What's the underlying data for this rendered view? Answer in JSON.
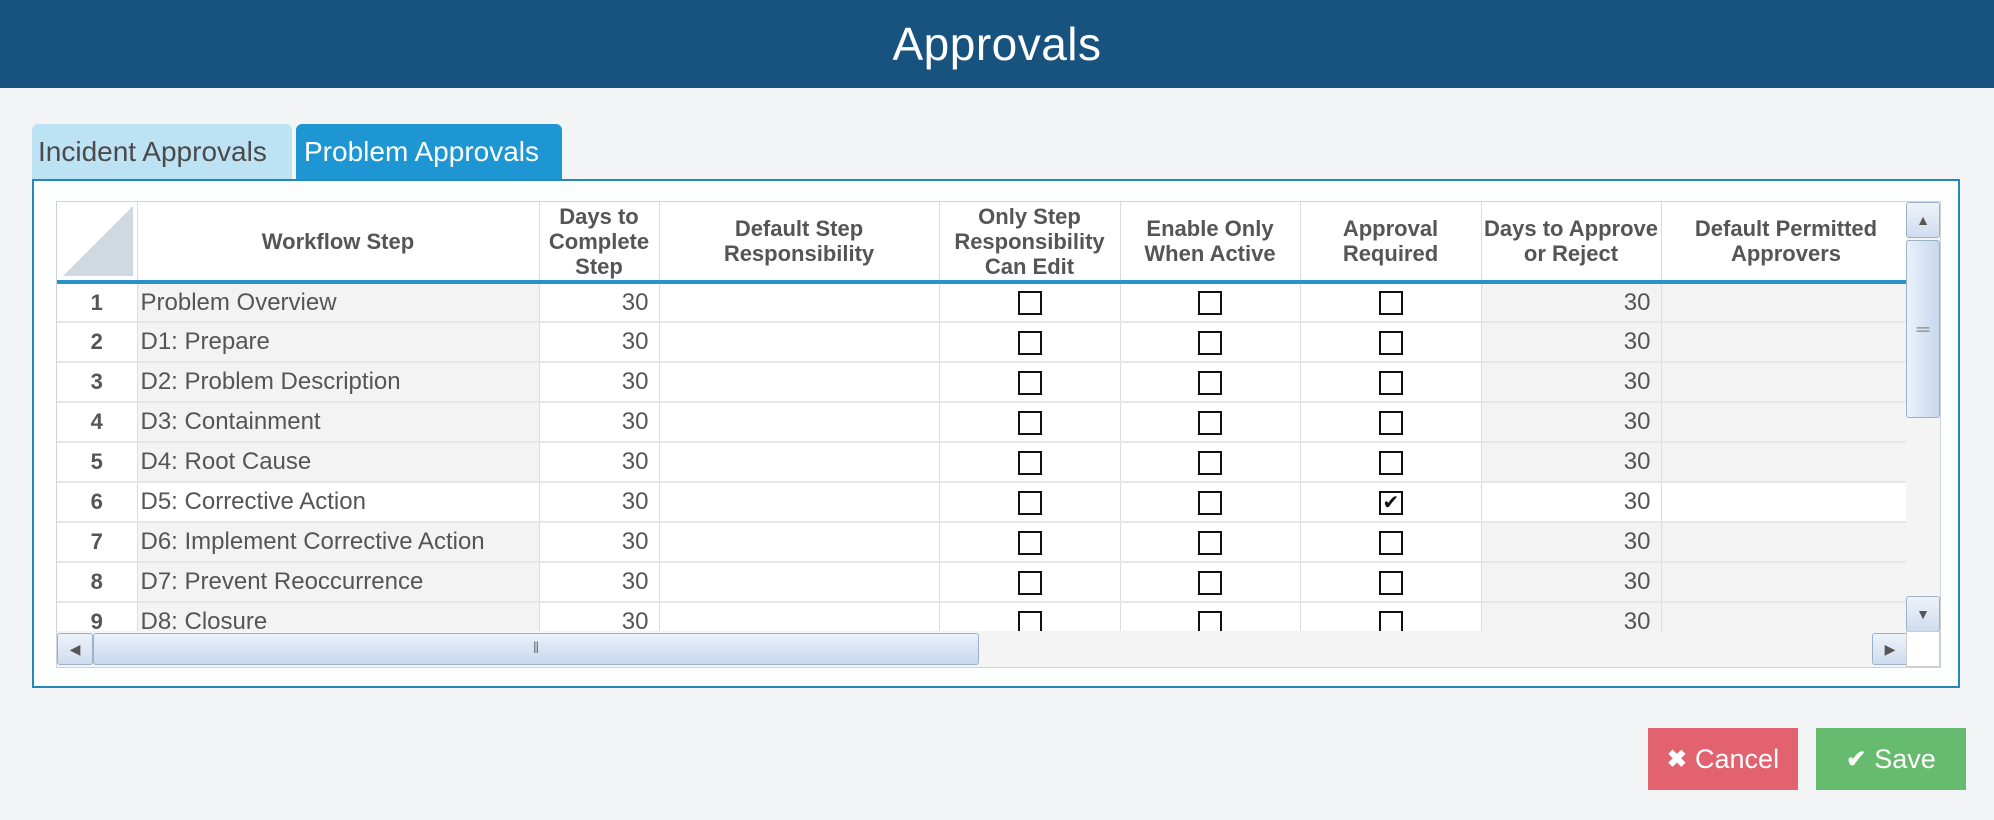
{
  "header": {
    "title": "Approvals"
  },
  "tabs": [
    {
      "label": "Incident Approvals",
      "active": false
    },
    {
      "label": "Problem Approvals",
      "active": true
    }
  ],
  "grid": {
    "columns": [
      {
        "key": "rownum",
        "label": ""
      },
      {
        "key": "step",
        "label": "Workflow Step"
      },
      {
        "key": "days_complete",
        "label": "Days to Complete Step"
      },
      {
        "key": "responsibility",
        "label": "Default Step Responsibility"
      },
      {
        "key": "only_resp_edit",
        "label": "Only Step Responsibility Can Edit"
      },
      {
        "key": "enable_active",
        "label": "Enable Only When Active"
      },
      {
        "key": "approval_required",
        "label": "Approval Required"
      },
      {
        "key": "days_approve",
        "label": "Days to Approve or Reject"
      },
      {
        "key": "approvers",
        "label": "Default Permitted Approvers"
      }
    ],
    "rows": [
      {
        "num": "1",
        "step": "Problem Overview",
        "days_complete": "30",
        "responsibility": "",
        "only_resp_edit": false,
        "enable_active": false,
        "approval_required": false,
        "days_approve": "30",
        "approvers": ""
      },
      {
        "num": "2",
        "step": "D1: Prepare",
        "days_complete": "30",
        "responsibility": "",
        "only_resp_edit": false,
        "enable_active": false,
        "approval_required": false,
        "days_approve": "30",
        "approvers": ""
      },
      {
        "num": "3",
        "step": "D2: Problem Description",
        "days_complete": "30",
        "responsibility": "",
        "only_resp_edit": false,
        "enable_active": false,
        "approval_required": false,
        "days_approve": "30",
        "approvers": ""
      },
      {
        "num": "4",
        "step": "D3: Containment",
        "days_complete": "30",
        "responsibility": "",
        "only_resp_edit": false,
        "enable_active": false,
        "approval_required": false,
        "days_approve": "30",
        "approvers": ""
      },
      {
        "num": "5",
        "step": "D4: Root Cause",
        "days_complete": "30",
        "responsibility": "",
        "only_resp_edit": false,
        "enable_active": false,
        "approval_required": false,
        "days_approve": "30",
        "approvers": ""
      },
      {
        "num": "6",
        "step": "D5: Corrective Action",
        "days_complete": "30",
        "responsibility": "",
        "only_resp_edit": false,
        "enable_active": false,
        "approval_required": true,
        "days_approve": "30",
        "approvers": ""
      },
      {
        "num": "7",
        "step": "D6: Implement Corrective Action",
        "days_complete": "30",
        "responsibility": "",
        "only_resp_edit": false,
        "enable_active": false,
        "approval_required": false,
        "days_approve": "30",
        "approvers": ""
      },
      {
        "num": "8",
        "step": "D7: Prevent Reoccurrence",
        "days_complete": "30",
        "responsibility": "",
        "only_resp_edit": false,
        "enable_active": false,
        "approval_required": false,
        "days_approve": "30",
        "approvers": ""
      },
      {
        "num": "9",
        "step": "D8: Closure",
        "days_complete": "30",
        "responsibility": "",
        "only_resp_edit": false,
        "enable_active": false,
        "approval_required": false,
        "days_approve": "30",
        "approvers": ""
      }
    ]
  },
  "icons": {
    "scroll_up": "▲",
    "scroll_down": "▼",
    "scroll_left": "◀",
    "scroll_right": "▶",
    "vgrip": "═",
    "hgrip": "‖",
    "cancel": "✖",
    "save": "✔"
  },
  "actions": {
    "cancel_label": "Cancel",
    "save_label": "Save"
  },
  "colors": {
    "header_bg": "#18527e",
    "tab_active": "#1e96d4",
    "tab_inactive": "#bde2f4",
    "cancel": "#e2636f",
    "save": "#66bb6e",
    "grid_accent": "#2a92c8"
  }
}
